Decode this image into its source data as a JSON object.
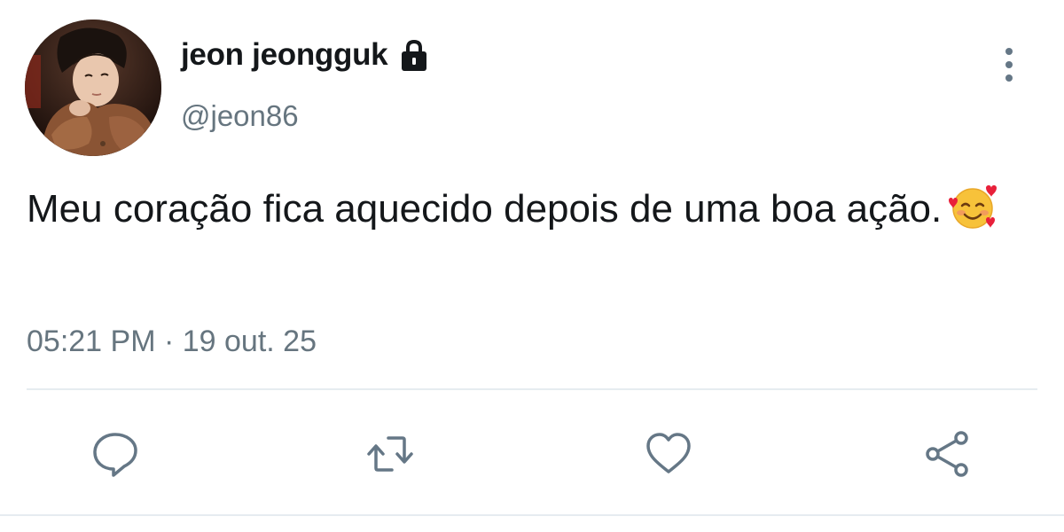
{
  "tweet": {
    "author": {
      "display_name": "jeon jeongguk",
      "handle": "@jeon86",
      "avatar": "profile-photo",
      "protected_icon": "lock-icon"
    },
    "menu_icon": "more-vertical-icon",
    "text": "Meu coração fica aquecido depois de uma boa ação.",
    "emoji": "smiling-face-with-hearts-emoji",
    "timestamp": "05:21 PM · 19 out. 25",
    "actions": [
      {
        "name": "reply",
        "icon": "comment-icon"
      },
      {
        "name": "retweet",
        "icon": "retweet-icon"
      },
      {
        "name": "like",
        "icon": "heart-icon"
      },
      {
        "name": "share",
        "icon": "share-icon"
      }
    ]
  },
  "colors": {
    "text_primary": "#14171a",
    "text_secondary": "#66757f",
    "icon": "#657786",
    "divider": "#e6ecf0",
    "background": "#ffffff"
  }
}
